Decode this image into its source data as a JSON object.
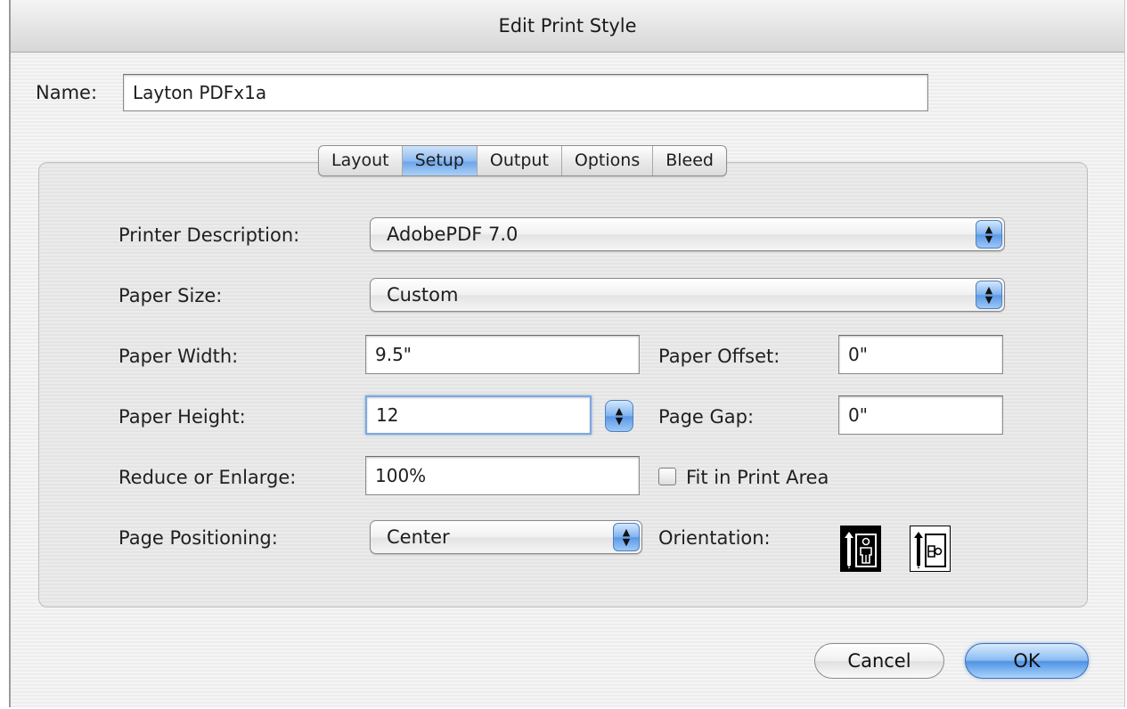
{
  "window": {
    "title": "Edit Print Style"
  },
  "name_field": {
    "label": "Name:",
    "value": "Layton PDFx1a"
  },
  "tabs": [
    {
      "label": "Layout",
      "active": false
    },
    {
      "label": "Setup",
      "active": true
    },
    {
      "label": "Output",
      "active": false
    },
    {
      "label": "Options",
      "active": false
    },
    {
      "label": "Bleed",
      "active": false
    }
  ],
  "setup": {
    "printer_description": {
      "label": "Printer Description:",
      "value": "AdobePDF 7.0"
    },
    "paper_size": {
      "label": "Paper Size:",
      "value": "Custom"
    },
    "paper_width": {
      "label": "Paper Width:",
      "value": "9.5\""
    },
    "paper_offset": {
      "label": "Paper Offset:",
      "value": "0\""
    },
    "paper_height": {
      "label": "Paper Height:",
      "value": "12"
    },
    "page_gap": {
      "label": "Page Gap:",
      "value": "0\""
    },
    "reduce_enlarge": {
      "label": "Reduce or Enlarge:",
      "value": "100%"
    },
    "fit_in_print_area": {
      "label": "Fit in Print Area",
      "checked": false
    },
    "page_positioning": {
      "label": "Page Positioning:",
      "value": "Center"
    },
    "orientation": {
      "label": "Orientation:",
      "selected": "portrait"
    }
  },
  "buttons": {
    "cancel": "Cancel",
    "ok": "OK"
  },
  "colors": {
    "accent": "#6fa6ea",
    "focus_ring": "#7fa8dd"
  }
}
